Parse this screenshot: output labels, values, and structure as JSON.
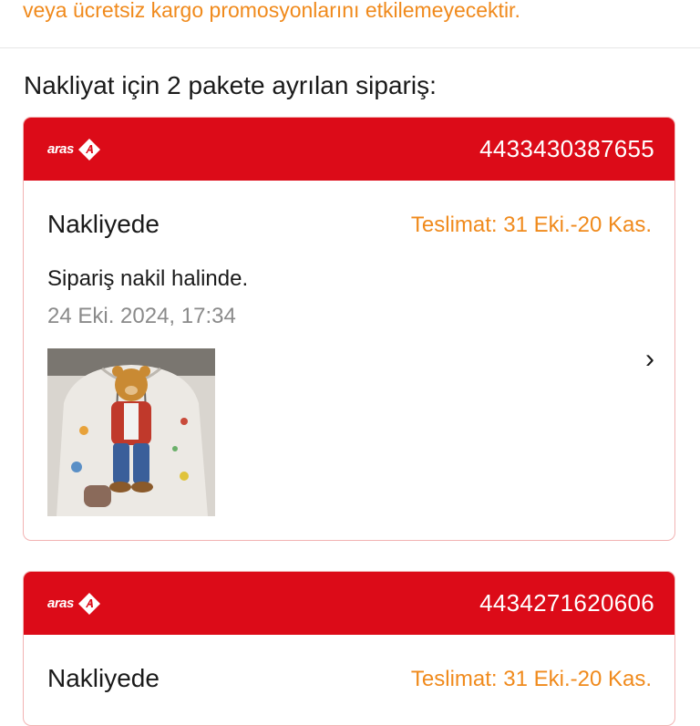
{
  "notice": "veya ücretsiz kargo promosyonlarını etkilemeyecektir.",
  "section_title": "Nakliyat için 2 pakete ayrılan sipariş:",
  "colors": {
    "accent": "#dc0b18",
    "eta": "#f08a1c",
    "muted": "#8a8a8a"
  },
  "packages": [
    {
      "carrier": "aras",
      "tracking": "4433430387655",
      "status": "Nakliyede",
      "eta": "Teslimat: 31 Eki.-20 Kas.",
      "message": "Sipariş nakil halinde.",
      "time": "24 Eki. 2024, 17:34",
      "thumbnail_icon": "hoodie-teddy-bear-product-image",
      "chevron": "›"
    },
    {
      "carrier": "aras",
      "tracking": "4434271620606",
      "status": "Nakliyede",
      "eta": "Teslimat: 31 Eki.-20 Kas."
    }
  ]
}
